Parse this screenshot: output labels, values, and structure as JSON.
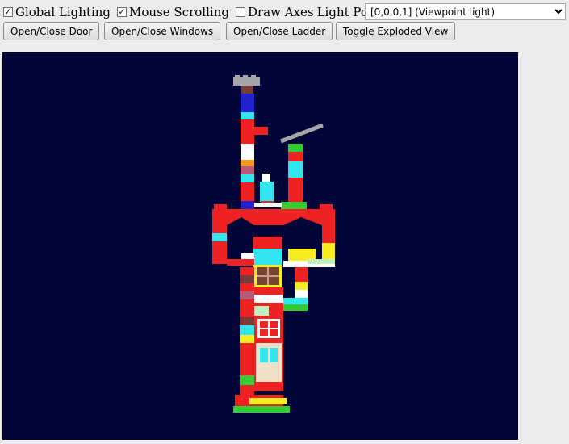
{
  "controls": {
    "global_lighting": {
      "label": "Global Lighting",
      "checked": true
    },
    "mouse_scrolling": {
      "label": "Mouse Scrolling",
      "checked": true
    },
    "draw_axes": {
      "label": "Draw Axes",
      "checked": false
    },
    "light_position_label": "Light Position:",
    "light_position_value": "[0,0,0,1] (Viewpoint light)"
  },
  "buttons": {
    "door": "Open/Close Door",
    "windows": "Open/Close Windows",
    "ladder": "Open/Close Ladder",
    "exploded": "Toggle Exploded View"
  },
  "colors": {
    "viewport_bg": "#020538",
    "brick_red": "#ee2222",
    "cyan": "#33e6ee",
    "yellow": "#f6ee22",
    "green": "#33cc33"
  }
}
